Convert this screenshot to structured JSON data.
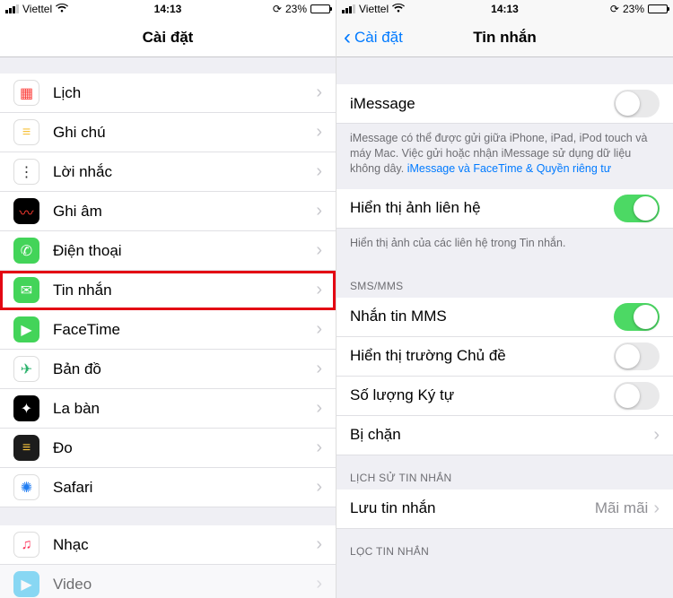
{
  "status": {
    "carrier": "Viettel",
    "time": "14:13",
    "battery_pct": "23%"
  },
  "left": {
    "title": "Cài đặt",
    "items": [
      {
        "label": "Lịch",
        "icon_bg": "#ffffff",
        "icon_fg": "#fc3d39"
      },
      {
        "label": "Ghi chú",
        "icon_bg": "#ffffff",
        "icon_fg": "#f7c33d"
      },
      {
        "label": "Lời nhắc",
        "icon_bg": "#ffffff",
        "icon_fg": "#333"
      },
      {
        "label": "Ghi âm",
        "icon_bg": "#000000",
        "icon_fg": "#ff3b30"
      },
      {
        "label": "Điện thoại",
        "icon_bg": "#43d459",
        "icon_fg": "#ffffff"
      },
      {
        "label": "Tin nhắn",
        "icon_bg": "#43d459",
        "icon_fg": "#ffffff"
      },
      {
        "label": "FaceTime",
        "icon_bg": "#43d459",
        "icon_fg": "#ffffff"
      },
      {
        "label": "Bản đồ",
        "icon_bg": "#ffffff",
        "icon_fg": "#2ab26b"
      },
      {
        "label": "La bàn",
        "icon_bg": "#000000",
        "icon_fg": "#ffffff"
      },
      {
        "label": "Đo",
        "icon_bg": "#1c1c1c",
        "icon_fg": "#f7c33d"
      },
      {
        "label": "Safari",
        "icon_bg": "#ffffff",
        "icon_fg": "#1f7cf2"
      }
    ],
    "extra": [
      {
        "label": "Nhạc",
        "icon_bg": "#ffffff",
        "icon_fg": "#fc3158"
      },
      {
        "label": "Video",
        "icon_bg": "#33c3f2",
        "icon_fg": "#ffffff"
      }
    ]
  },
  "right": {
    "back": "Cài đặt",
    "title": "Tin nhắn",
    "imessage_label": "iMessage",
    "imessage_footer_a": "iMessage có thể được gửi giữa iPhone, iPad, iPod touch và máy Mac. Việc gửi hoặc nhận iMessage sử dụng dữ liệu không dây. ",
    "imessage_footer_link": "iMessage và FaceTime & Quyền riêng tư",
    "show_photos_label": "Hiển thị ảnh liên hệ",
    "show_photos_footer": "Hiển thị ảnh của các liên hệ trong Tin nhắn.",
    "section_smsmms": "SMS/MMS",
    "mms_label": "Nhắn tin MMS",
    "subject_label": "Hiển thị trường Chủ đề",
    "charcount_label": "Số lượng Ký tự",
    "blocked_label": "Bị chặn",
    "section_history": "LỊCH SỬ TIN NHẮN",
    "keep_label": "Lưu tin nhắn",
    "keep_value": "Mãi mãi",
    "section_filter": "LỌC TIN NHẮN"
  }
}
